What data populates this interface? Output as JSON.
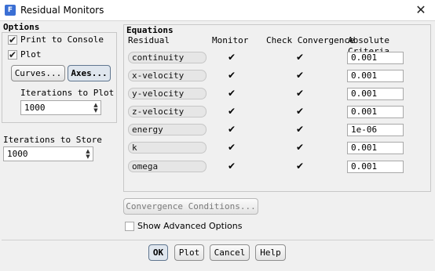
{
  "window": {
    "title": "Residual Monitors",
    "icon_letter": "F"
  },
  "options": {
    "title": "Options",
    "print_to_console": {
      "label": "Print to Console",
      "checked": true
    },
    "plot": {
      "label": "Plot",
      "checked": true
    },
    "curves_button": "Curves...",
    "axes_button": "Axes...",
    "iterations_to_plot": {
      "label": "Iterations to Plot",
      "value": "1000"
    },
    "iterations_to_store": {
      "label": "Iterations to Store",
      "value": "1000"
    }
  },
  "equations": {
    "title": "Equations",
    "headers": {
      "residual": "Residual",
      "monitor": "Monitor",
      "check": "Check Convergence",
      "criteria": "Absolute Criteria"
    },
    "rows": [
      {
        "name": "continuity",
        "monitor": true,
        "check": true,
        "criteria": "0.001"
      },
      {
        "name": "x-velocity",
        "monitor": true,
        "check": true,
        "criteria": "0.001"
      },
      {
        "name": "y-velocity",
        "monitor": true,
        "check": true,
        "criteria": "0.001"
      },
      {
        "name": "z-velocity",
        "monitor": true,
        "check": true,
        "criteria": "0.001"
      },
      {
        "name": "energy",
        "monitor": true,
        "check": true,
        "criteria": "1e-06"
      },
      {
        "name": "k",
        "monitor": true,
        "check": true,
        "criteria": "0.001"
      },
      {
        "name": "omega",
        "monitor": true,
        "check": true,
        "criteria": "0.001"
      }
    ]
  },
  "convergence_conditions_button": "Convergence Conditions...",
  "show_advanced": {
    "label": "Show Advanced Options",
    "checked": false
  },
  "footer": {
    "ok": "OK",
    "plot": "Plot",
    "cancel": "Cancel",
    "help": "Help"
  },
  "icons": {
    "check": "✔",
    "close": "✕",
    "spin_up": "▲",
    "spin_down": "▼"
  },
  "colors": {
    "client_bg": "#f0f0f0",
    "ok_focus": "#dfe6ee"
  }
}
